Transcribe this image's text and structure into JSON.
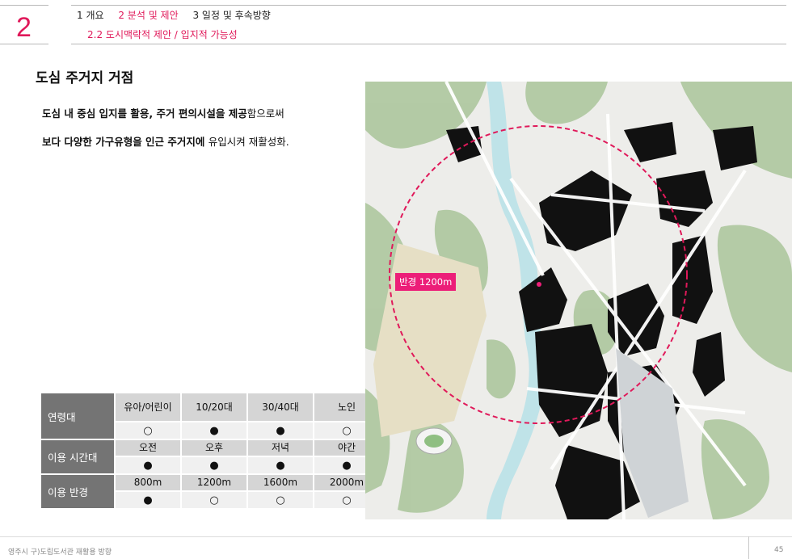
{
  "section_number": "2",
  "nav": {
    "items": [
      "1 개요",
      "2 분석 및 제안",
      "3 일정 및 후속방향"
    ],
    "sub": "2.2 도시맥락적 제안 / 입지적 가능성"
  },
  "title": "도심 주거지 거점",
  "body": {
    "line1_a": "도심 내 중심 입지를 활용, 주거 편의시설을 제공",
    "line1_b": "함으로써",
    "line2_a": "보다 다양한 가구유형을 인근 주거지에 ",
    "line2_b": "유입시켜 재활성화."
  },
  "table": {
    "rows": [
      {
        "header": "연령대",
        "columns": [
          "유아/어린이",
          "10/20대",
          "30/40대",
          "노인"
        ],
        "values": [
          "○",
          "●",
          "●",
          "○"
        ]
      },
      {
        "header": "이용 시간대",
        "columns": [
          "오전",
          "오후",
          "저녁",
          "야간"
        ],
        "values": [
          "●",
          "●",
          "●",
          "●"
        ]
      },
      {
        "header": "이용 반경",
        "columns": [
          "800m",
          "1200m",
          "1600m",
          "2000m"
        ],
        "values": [
          "●",
          "○",
          "○",
          "○"
        ]
      }
    ]
  },
  "map": {
    "radius_label": "반경 1200m",
    "accent_color": "#e0195a"
  },
  "footer": {
    "text": "영주시 구)도립도서관 재활용 방향",
    "page": "45"
  }
}
